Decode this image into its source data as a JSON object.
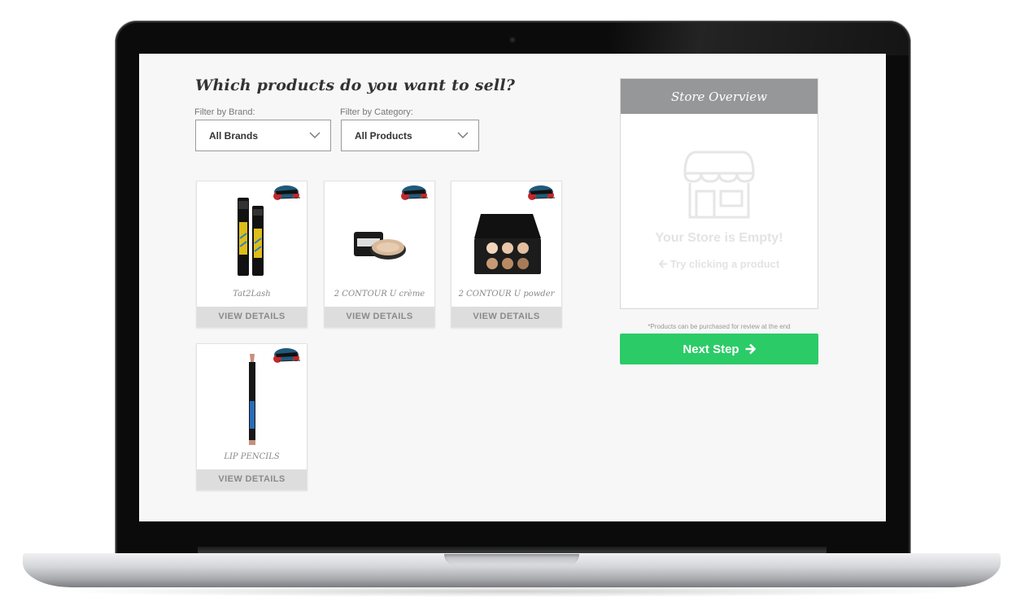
{
  "page": {
    "heading": "Which products do you want to sell?"
  },
  "filters": {
    "brand": {
      "label": "Filter by Brand:",
      "value": "All Brands"
    },
    "category": {
      "label": "Filter by Category:",
      "value": "All Products"
    }
  },
  "products": [
    {
      "name": "Tat2Lash",
      "action": "VIEW DETAILS",
      "image": "mascara-icon"
    },
    {
      "name": "2 CONTOUR U crème",
      "action": "VIEW DETAILS",
      "image": "compact-icon"
    },
    {
      "name": "2 CONTOUR U powder",
      "action": "VIEW DETAILS",
      "image": "palette-icon"
    },
    {
      "name": "LIP PENCILS",
      "action": "VIEW DETAILS",
      "image": "lip-pencil-icon"
    }
  ],
  "store_overview": {
    "title": "Store Overview",
    "empty_text": "Your Store is Empty!",
    "hint": "Try clicking a product",
    "hint_icon": "arrow-left-icon",
    "store_icon": "storefront-icon"
  },
  "note": "*Products can be purchased for review at the end",
  "next_button": {
    "label": "Next Step",
    "icon": "arrow-right-icon",
    "color": "#2bcb68"
  }
}
